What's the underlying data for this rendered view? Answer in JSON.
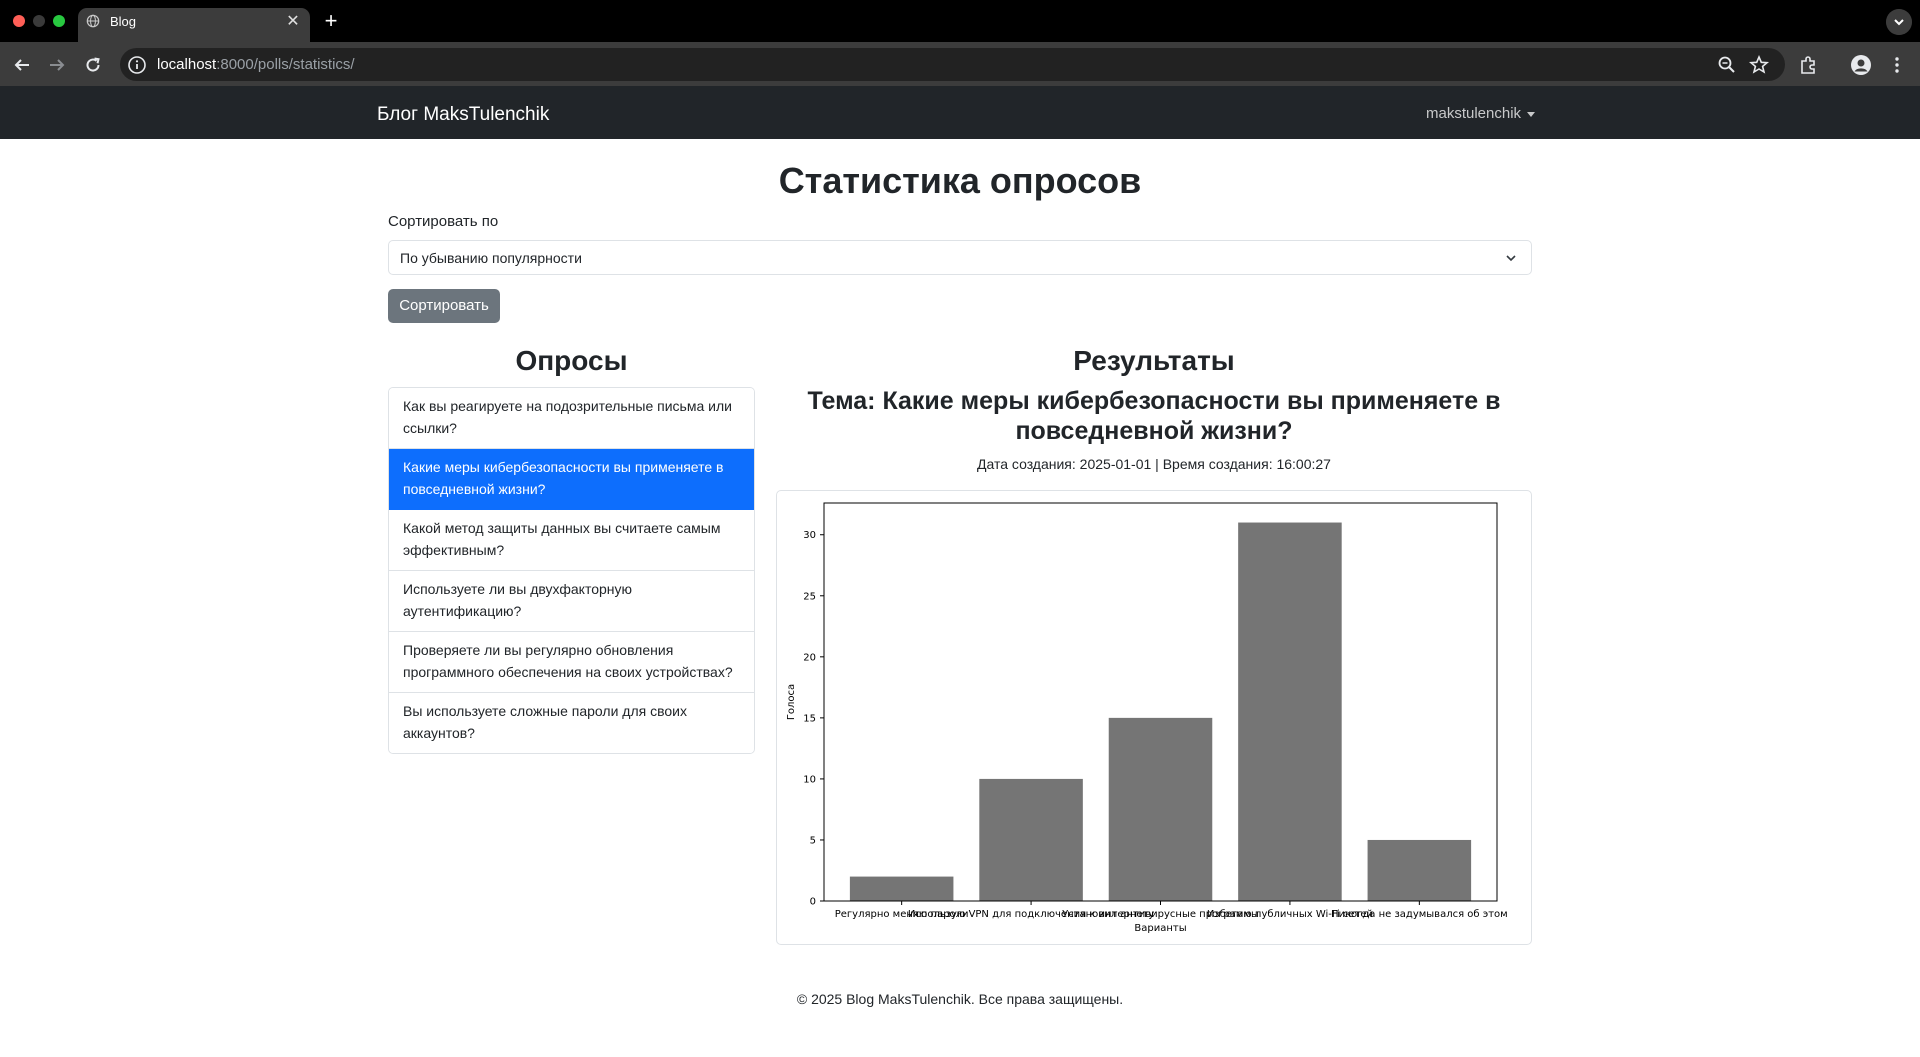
{
  "browser": {
    "tab_title": "Blog",
    "url_host": "localhost",
    "url_rest": ":8000/polls/statistics/"
  },
  "navbar": {
    "brand": "Блог MaksTulenchik",
    "user": "makstulenchik"
  },
  "page": {
    "title": "Статистика опросов",
    "sort_label": "Сортировать по",
    "sort_selected": "По убыванию популярности",
    "sort_button": "Сортировать"
  },
  "polls": {
    "heading": "Опросы",
    "items": [
      {
        "text": "Как вы реагируете на подозрительные письма или ссылки?",
        "active": false
      },
      {
        "text": "Какие меры кибербезопасности вы применяете в повседневной жизни?",
        "active": true
      },
      {
        "text": "Какой метод защиты данных вы считаете самым эффективным?",
        "active": false
      },
      {
        "text": "Используете ли вы двухфакторную аутентификацию?",
        "active": false
      },
      {
        "text": "Проверяете ли вы регулярно обновления программного обеспечения на своих устройствах?",
        "active": false
      },
      {
        "text": "Вы используете сложные пароли для своих аккаунтов?",
        "active": false
      }
    ]
  },
  "results": {
    "heading": "Результаты",
    "topic": "Тема: Какие меры кибербезопасности вы применяете в повседневной жизни?",
    "meta": "Дата создания: 2025-01-01 | Время создания: 16:00:27"
  },
  "chart_data": {
    "type": "bar",
    "categories": [
      "Регулярно меняю пароли",
      "Использую VPN для подключения к интернету",
      "Установил антивирусные программы",
      "Избегаю публичных Wi-Fi сетей",
      "Никогда не задумывался об этом"
    ],
    "values": [
      2,
      10,
      15,
      31,
      5
    ],
    "xlabel": "Варианты",
    "ylabel": "Голоса",
    "ylim": [
      0,
      32.6
    ],
    "yticks": [
      0,
      5,
      10,
      15,
      20,
      25,
      30
    ],
    "bar_color": "#757575",
    "grid": false
  },
  "footer": {
    "text": "© 2025 Blog MaksTulenchik. Все права защищены."
  },
  "colors": {
    "navbar_bg": "#212529",
    "active_item": "#0d6efd",
    "sort_button": "#6c757d"
  }
}
